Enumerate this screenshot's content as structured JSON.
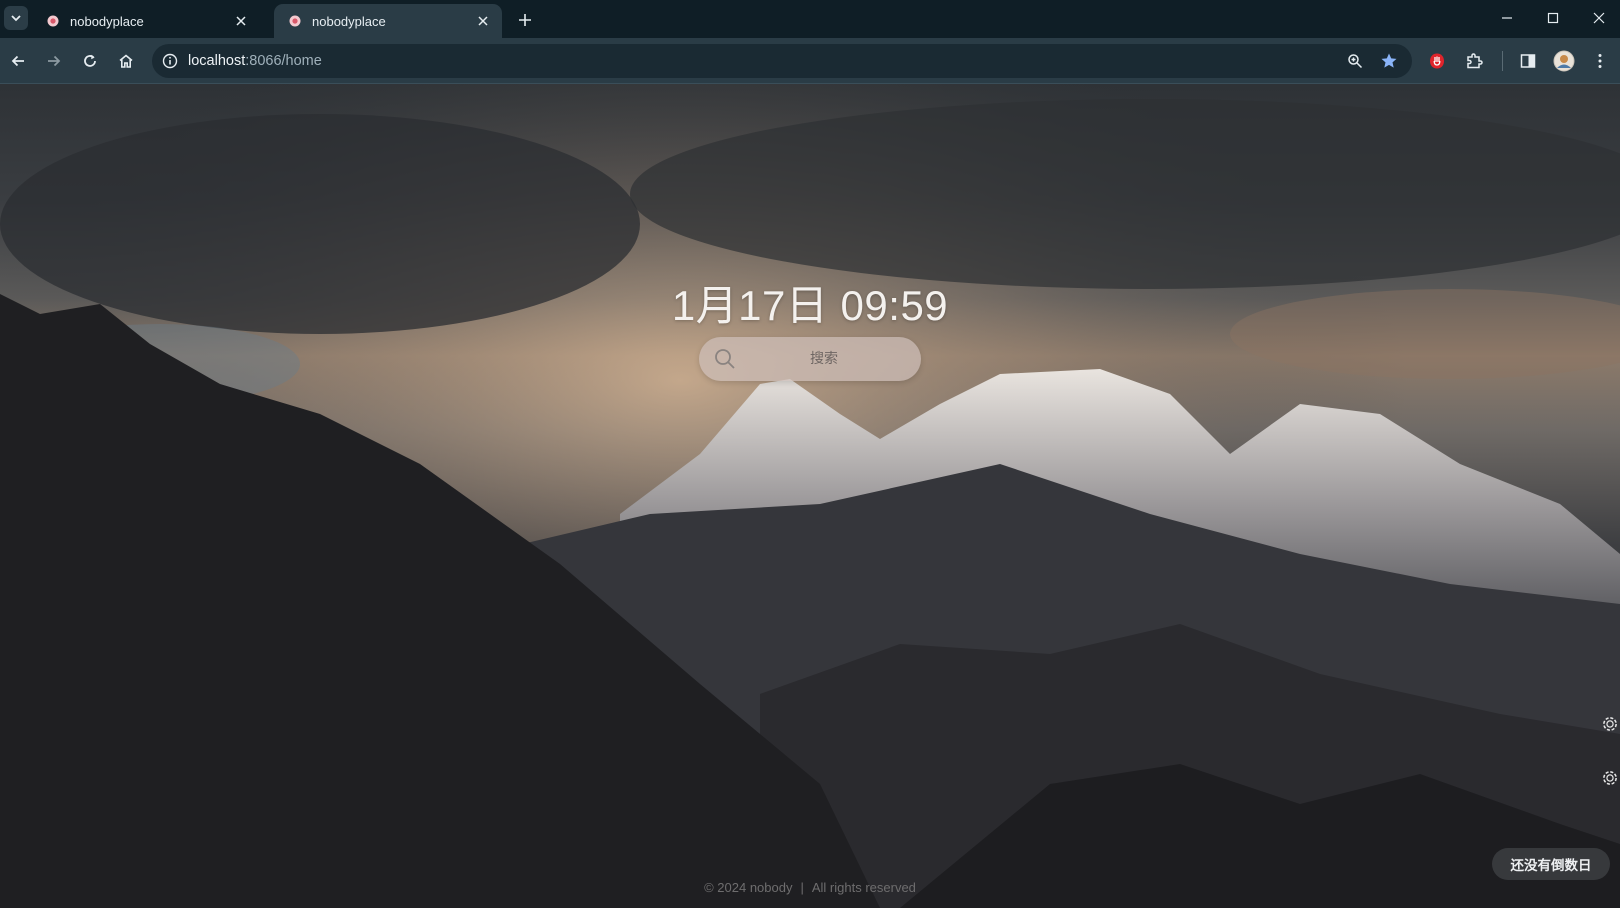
{
  "browser": {
    "tabs": [
      {
        "title": "nobodyplace",
        "active": false
      },
      {
        "title": "nobodyplace",
        "active": true
      }
    ],
    "url": {
      "host": "localhost",
      "path": ":8066/home"
    },
    "icons": {
      "tab_search": "chevron-down-icon",
      "new_tab": "plus-icon",
      "back": "arrow-left-icon",
      "forward": "arrow-right-icon",
      "reload": "reload-icon",
      "home": "home-icon",
      "site_info": "info-icon",
      "zoom": "zoom-icon",
      "bookmark": "star-icon",
      "extension_red": "red-hand-icon",
      "extensions": "puzzle-icon",
      "side_panel": "side-panel-icon",
      "profile": "avatar-icon",
      "menu": "kebab-menu-icon"
    },
    "colors": {
      "titlebar": "#0f1e26",
      "toolbar": "#2a3c46",
      "bookmark_star": "#8ab4f8",
      "extension_red": "#e0242b"
    }
  },
  "page": {
    "clock": "1月17日 09:59",
    "search": {
      "placeholder": "搜索"
    },
    "countdown_button": "还没有倒数日",
    "footer": {
      "copyright": "© 2024 nobody",
      "separator": "|",
      "rights": "All rights reserved"
    },
    "side_icons": [
      "gear-icon",
      "gear-icon"
    ]
  }
}
